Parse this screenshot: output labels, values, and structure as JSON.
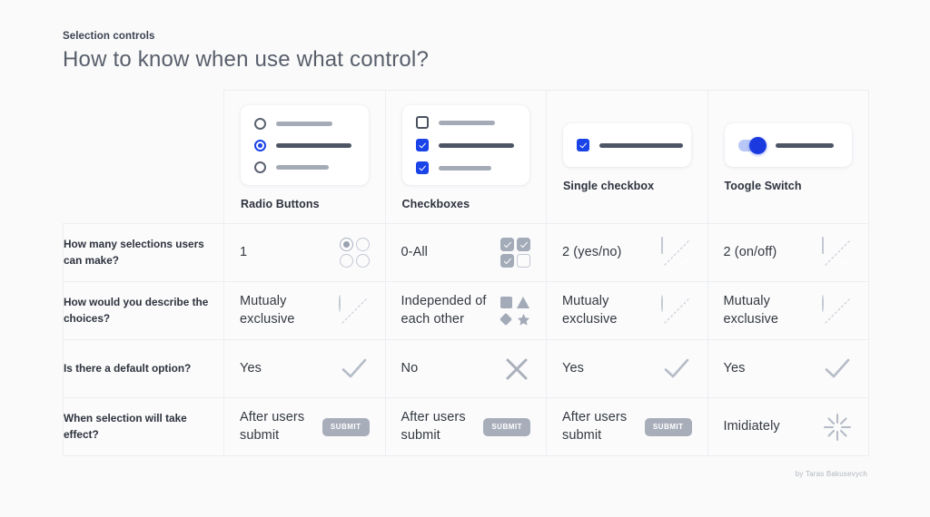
{
  "header": {
    "kicker": "Selection controls",
    "headline": "How to know when use what control?"
  },
  "columns": [
    {
      "id": "radio",
      "title": "Radio Buttons"
    },
    {
      "id": "checkbox",
      "title": "Checkboxes"
    },
    {
      "id": "single-checkbox",
      "title": "Single checkbox"
    },
    {
      "id": "toggle",
      "title": "Toogle Switch"
    }
  ],
  "rows": [
    {
      "question": "How many selections users can make?",
      "cells": [
        {
          "text": "1",
          "icon": "radio-grid-icon"
        },
        {
          "text": "0-All",
          "icon": "checkbox-grid-icon"
        },
        {
          "text": "2 (yes/no)",
          "icon": "exclusive-checkbox-icon"
        },
        {
          "text": "2 (on/off)",
          "icon": "exclusive-checkbox-icon"
        }
      ]
    },
    {
      "question": "How would you describe the choices?",
      "cells": [
        {
          "text": "Mutualy exclusive",
          "icon": "exclusive-radio-icon"
        },
        {
          "text": "Independed of each other",
          "icon": "shapes-icon"
        },
        {
          "text": "Mutualy exclusive",
          "icon": "exclusive-radio-icon"
        },
        {
          "text": "Mutualy exclusive",
          "icon": "exclusive-radio-icon"
        }
      ]
    },
    {
      "question": "Is there a default option?",
      "cells": [
        {
          "text": "Yes",
          "icon": "check-icon"
        },
        {
          "text": "No",
          "icon": "close-icon"
        },
        {
          "text": "Yes",
          "icon": "check-icon"
        },
        {
          "text": "Yes",
          "icon": "check-icon"
        }
      ]
    },
    {
      "question": "When selection will take effect?",
      "cells": [
        {
          "text": "After users submit",
          "icon": "submit-button-icon",
          "button_label": "SUBMIT"
        },
        {
          "text": "After users submit",
          "icon": "submit-button-icon",
          "button_label": "SUBMIT"
        },
        {
          "text": "After users submit",
          "icon": "submit-button-icon",
          "button_label": "SUBMIT"
        },
        {
          "text": "Imidiately",
          "icon": "burst-icon"
        }
      ]
    }
  ],
  "credit": "by Taras Bakusevych",
  "colors": {
    "accent_blue": "#1a43e8",
    "toggle_track": "#b9c7f6",
    "muted_grey": "#a3aab8",
    "text_dark": "#2d323c",
    "page_bg": "#fafafa"
  }
}
